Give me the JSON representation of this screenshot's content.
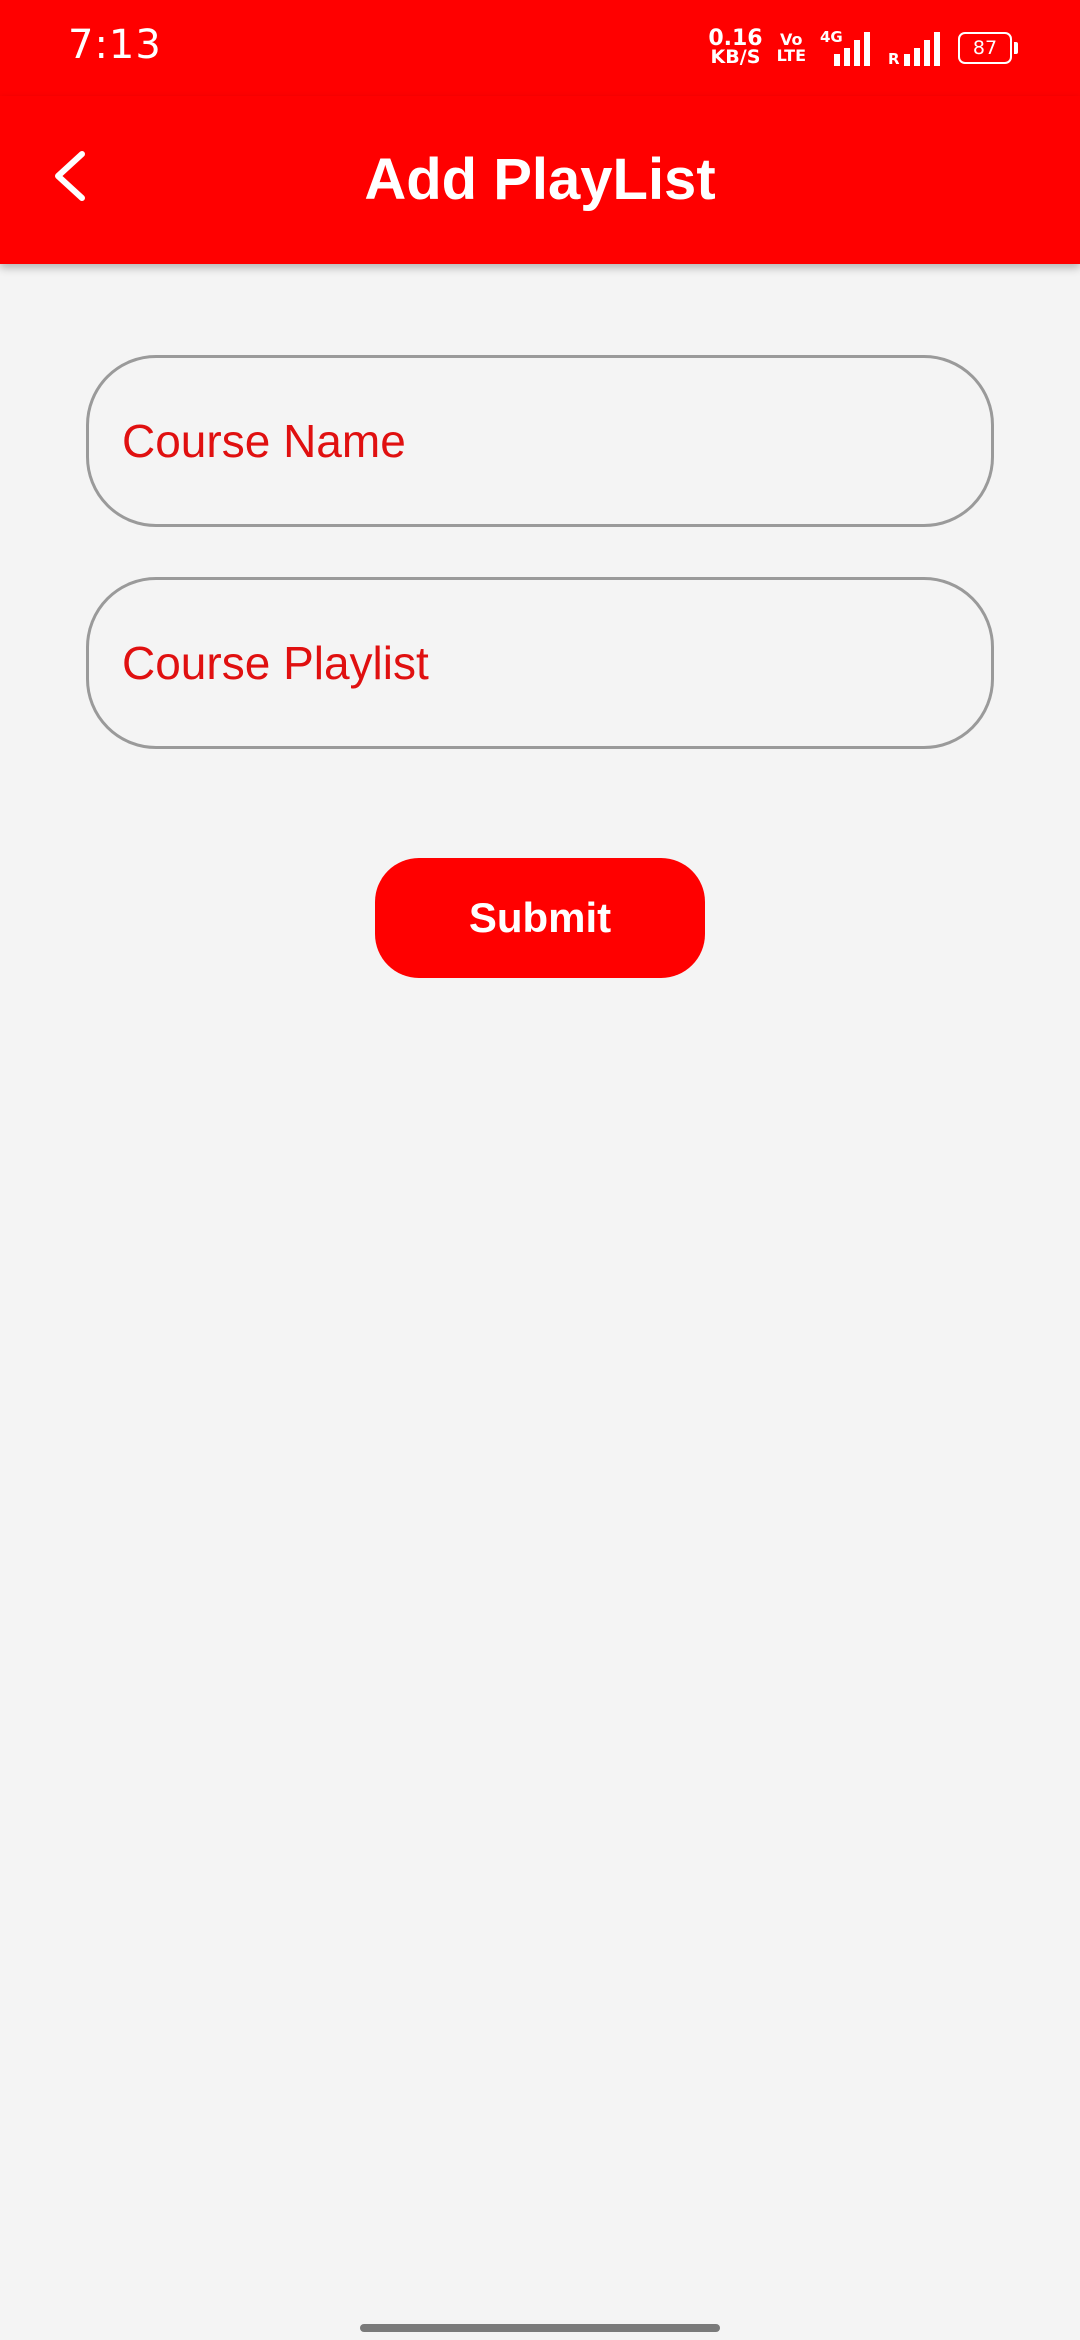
{
  "status_bar": {
    "time": "7:13",
    "net_speed_value": "0.16",
    "net_speed_unit": "KB/S",
    "volte_top": "Vo",
    "volte_bottom": "LTE",
    "network_type": "4G",
    "roaming_label": "R",
    "battery_level": "87"
  },
  "app_bar": {
    "title": "Add PlayList",
    "background_color": "#ff0000"
  },
  "form": {
    "course_name": {
      "placeholder": "Course Name",
      "value": ""
    },
    "course_playlist": {
      "placeholder": "Course Playlist",
      "value": ""
    },
    "submit_label": "Submit"
  },
  "colors": {
    "accent": "#ff0000",
    "placeholder_text": "#e01010",
    "background": "#f4f4f4"
  }
}
